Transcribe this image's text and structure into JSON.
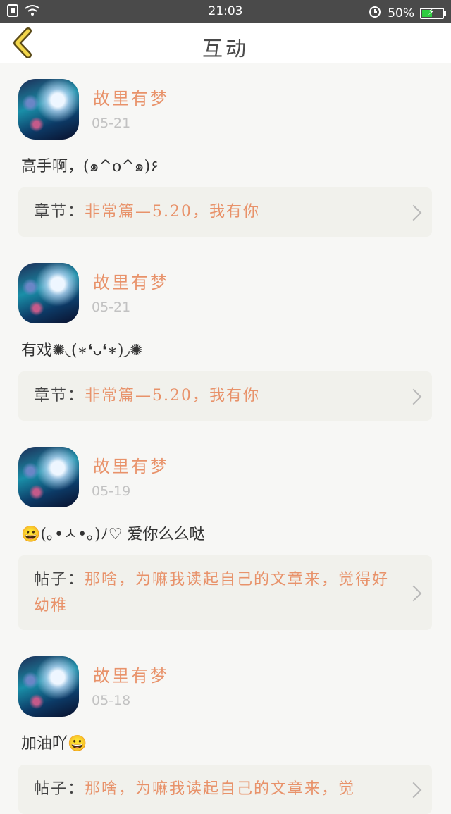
{
  "status_bar": {
    "time": "21:03",
    "battery": "50%",
    "battery_level": 0.5,
    "icons": [
      "sim-icon",
      "wifi-icon",
      "alarm-icon",
      "battery-icon"
    ]
  },
  "header": {
    "title": "互动",
    "back_icon": "chevron-left-icon"
  },
  "items": [
    {
      "user": "故里有梦",
      "date": "05-21",
      "content": "高手啊，(๑^o^๑)۶",
      "ref_label": "章节：",
      "ref_value": "非常篇—5.20，我有你"
    },
    {
      "user": "故里有梦",
      "date": "05-21",
      "content": "有戏✺◟(∗❛ᴗ❛∗)◞✺",
      "ref_label": "章节：",
      "ref_value": "非常篇—5.20，我有你"
    },
    {
      "user": "故里有梦",
      "date": "05-19",
      "content": "😀(｡•ㅅ•｡)ﾉ♡ 爱你么么哒",
      "ref_label": "帖子：",
      "ref_value": "那啥，为嘛我读起自己的文章来，觉得好幼稚"
    },
    {
      "user": "故里有梦",
      "date": "05-18",
      "content": "加油吖😀",
      "ref_label": "帖子：",
      "ref_value": "那啥，为嘛我读起自己的文章来，觉"
    }
  ]
}
